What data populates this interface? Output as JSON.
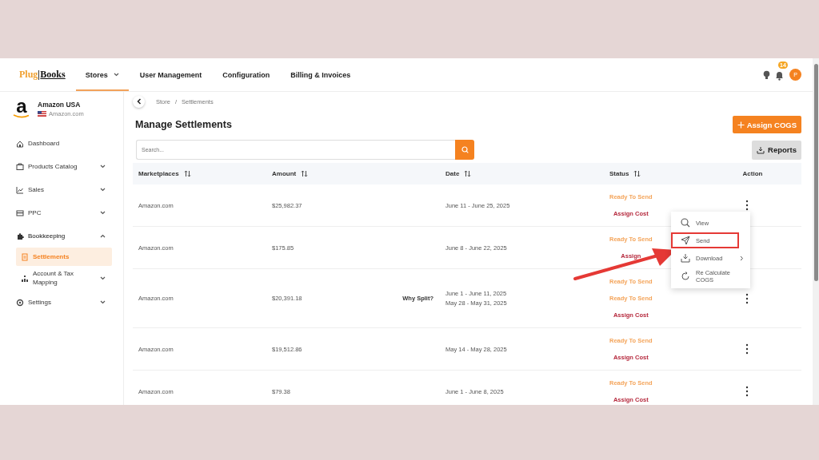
{
  "nav": {
    "logo": {
      "part_1": "Plug",
      "part_2": "Books"
    },
    "tabs": [
      {
        "label": "Stores",
        "selected": true,
        "dropdown": true
      },
      {
        "label": "User Management",
        "selected": false
      },
      {
        "label": "Configuration",
        "selected": false
      },
      {
        "label": "Billing & Invoices",
        "selected": false
      }
    ],
    "notifications": {
      "count": "14"
    },
    "avatar": {
      "initial": "P"
    }
  },
  "store": {
    "logo_letter": "a",
    "name": "Amazon USA",
    "domain": "Amazon.com"
  },
  "sidebar": {
    "items": [
      {
        "label": "Dashboard",
        "selected": false
      },
      {
        "label": "Products Catalog",
        "expanded": false,
        "selected": false
      },
      {
        "label": "Sales",
        "expanded": false,
        "selected": false
      },
      {
        "label": "PPC",
        "expanded": false,
        "selected": false
      },
      {
        "label": "Bookkeeping",
        "expanded": true,
        "selected": false,
        "children": [
          {
            "label": "Settlements",
            "selected": true
          },
          {
            "label": "Account & Tax Mapping",
            "expanded": false,
            "selected": false
          }
        ]
      },
      {
        "label": "Settings",
        "expanded": false,
        "selected": false
      }
    ]
  },
  "breadcrumb": {
    "items": [
      "Store",
      "Settlements"
    ],
    "separator": "/"
  },
  "page_title": "Manage Settlements",
  "assign_button": "Assign COGS",
  "search": {
    "placeholder": "Search..."
  },
  "reports_button": "Reports",
  "table": {
    "columns": [
      {
        "label": "Marketplaces",
        "sortable": true
      },
      {
        "label": "Amount",
        "sortable": true
      },
      {
        "label": "Date",
        "sortable": true
      },
      {
        "label": "Status",
        "sortable": true
      },
      {
        "label": "Action",
        "sortable": false
      }
    ],
    "rows": [
      {
        "marketplace": "Amazon.com",
        "amount": "$25,982.37",
        "dates": [
          "June 11 - June 25, 2025"
        ],
        "statuses": [
          {
            "kind": "ready",
            "text": "Ready To Send"
          },
          {
            "kind": "cost",
            "text": "Assign Cost"
          }
        ]
      },
      {
        "marketplace": "Amazon.com",
        "amount": "$175.85",
        "dates": [
          "June 8 - June 22, 2025"
        ],
        "statuses": [
          {
            "kind": "ready",
            "text": "Ready To Send"
          },
          {
            "kind": "cost",
            "text": "Assign"
          }
        ]
      },
      {
        "marketplace": "Amazon.com",
        "amount": "$20,391.18",
        "note": "Why Split?",
        "dates": [
          "June 1 - June 11, 2025",
          "May 28 - May 31, 2025"
        ],
        "statuses": [
          {
            "kind": "ready",
            "text": "Ready To Send"
          },
          {
            "kind": "ready",
            "text": "Ready To Send"
          },
          {
            "kind": "cost",
            "text": "Assign Cost"
          }
        ]
      },
      {
        "marketplace": "Amazon.com",
        "amount": "$19,512.86",
        "dates": [
          "May 14 - May 28, 2025"
        ],
        "statuses": [
          {
            "kind": "ready",
            "text": "Ready To Send"
          },
          {
            "kind": "cost",
            "text": "Assign Cost"
          }
        ]
      },
      {
        "marketplace": "Amazon.com",
        "amount": "$79.38",
        "dates": [
          "June 1 - June 8, 2025"
        ],
        "statuses": [
          {
            "kind": "ready",
            "text": "Ready To Send"
          },
          {
            "kind": "cost",
            "text": "Assign Cost"
          }
        ]
      }
    ]
  },
  "action_menu": {
    "items": [
      {
        "kind": "view",
        "label": "View",
        "highlighted": false,
        "submenu": false
      },
      {
        "kind": "send",
        "label": "Send",
        "highlighted": true,
        "submenu": false
      },
      {
        "kind": "download",
        "label": "Download",
        "highlighted": false,
        "submenu": true
      },
      {
        "kind": "recalc",
        "label": "Re Calculate COGS",
        "highlighted": false,
        "submenu": false
      }
    ]
  }
}
